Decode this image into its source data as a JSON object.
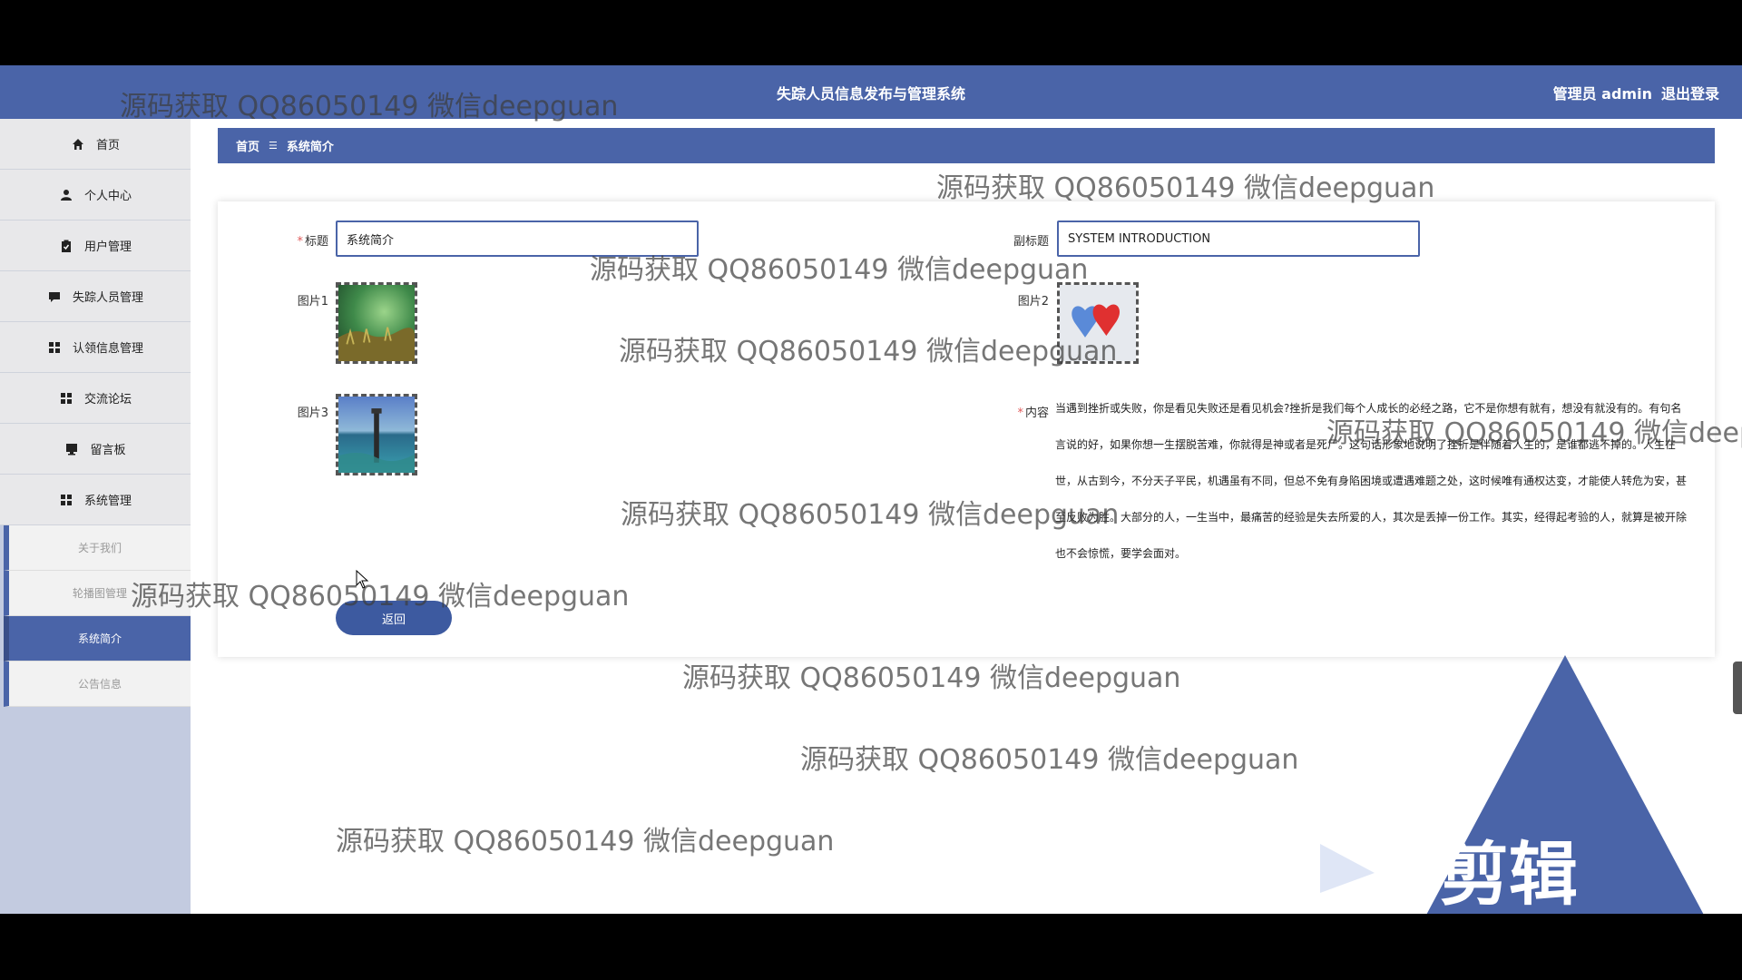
{
  "header": {
    "app_title": "失踪人员信息发布与管理系统",
    "user_label": "管理员 admin",
    "logout_label": "退出登录"
  },
  "sidebar": {
    "items": [
      {
        "label": "首页",
        "icon": "home-icon"
      },
      {
        "label": "个人中心",
        "icon": "user-icon"
      },
      {
        "label": "用户管理",
        "icon": "clipboard-icon"
      },
      {
        "label": "失踪人员管理",
        "icon": "comment-icon"
      },
      {
        "label": "认领信息管理",
        "icon": "grid-icon"
      },
      {
        "label": "交流论坛",
        "icon": "grid-icon"
      },
      {
        "label": "留言板",
        "icon": "monitor-icon"
      },
      {
        "label": "系统管理",
        "icon": "grid-icon"
      }
    ],
    "sub_items": [
      {
        "label": "关于我们"
      },
      {
        "label": "轮播图管理"
      },
      {
        "label": "系统简介"
      },
      {
        "label": "公告信息"
      }
    ],
    "active_sub_index": 2
  },
  "breadcrumb": {
    "home": "首页",
    "separator": "☰",
    "current": "系统简介"
  },
  "form": {
    "title_label": "标题",
    "title_value": "系统简介",
    "subtitle_label": "副标题",
    "subtitle_value": "SYSTEM INTRODUCTION",
    "image1_label": "图片1",
    "image2_label": "图片2",
    "image3_label": "图片3",
    "content_label": "内容",
    "content_value": "当遇到挫折或失败，你是看见失败还是看见机会?挫折是我们每个人成长的必经之路，它不是你想有就有，想没有就没有的。有句名言说的好，如果你想一生摆脱苦难，你就得是神或者是死尸。这句话形象地说明了挫折是伴随着人生的，是谁都逃不掉的。人生在世，从古到今，不分天子平民，机遇虽有不同，但总不免有身陷困境或遭遇难题之处，这时候唯有通权达变，才能使人转危为安，甚至反败为胜。大部分的人，一生当中，最痛苦的经验是失去所爱的人，其次是丢掉一份工作。其实，经得起考验的人，就算是被开除也不会惊慌，要学会面对。",
    "back_label": "返回",
    "required_mark": "*"
  },
  "watermark": {
    "text": "源码获取 QQ86050149 微信deepguan",
    "cut_text": "源码获取 QQ86050149 微信deep"
  },
  "overlay_logo": {
    "text": "V剪辑"
  },
  "colors": {
    "primary": "#4a64a8",
    "sidebar_bg": "#c3cbe0",
    "required": "#e05a5a"
  }
}
